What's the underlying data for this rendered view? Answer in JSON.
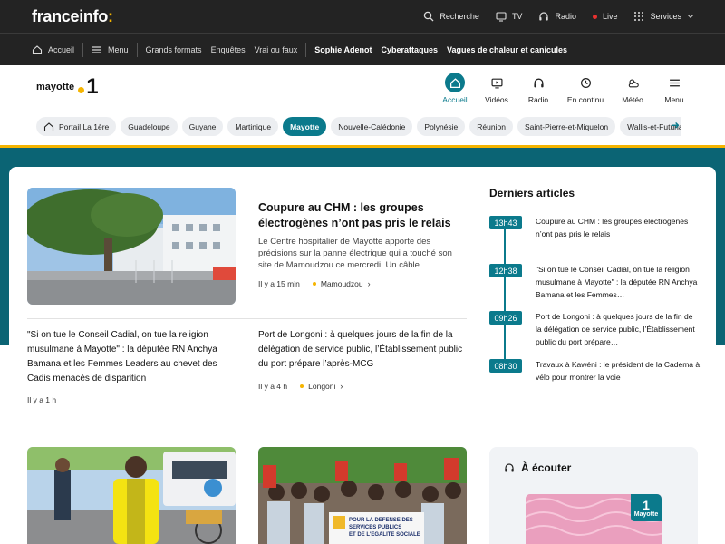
{
  "topbar": {
    "logo_main": "franceinfo",
    "logo_colon": ":",
    "search": "Recherche",
    "tv": "TV",
    "radio": "Radio",
    "live": "Live",
    "services": "Services"
  },
  "navbar": {
    "home": "Accueil",
    "menu": "Menu",
    "links": [
      "Grands formats",
      "Enquêtes",
      "Vrai ou faux"
    ],
    "bold_links": [
      "Sophie Adenot",
      "Cyberattaques",
      "Vagues de chaleur et canicules"
    ]
  },
  "header": {
    "brand_name": "mayotte",
    "brand_number": "1",
    "nav": [
      {
        "label": "Accueil",
        "icon": "home-icon"
      },
      {
        "label": "Vidéos",
        "icon": "play-icon"
      },
      {
        "label": "Radio",
        "icon": "headphones-icon"
      },
      {
        "label": "En continu",
        "icon": "clock-icon"
      },
      {
        "label": "Météo",
        "icon": "weather-icon"
      },
      {
        "label": "Menu",
        "icon": "hamburger-icon"
      }
    ],
    "regions": [
      "Portail La 1ère",
      "Guadeloupe",
      "Guyane",
      "Martinique",
      "Mayotte",
      "Nouvelle-Calédonie",
      "Polynésie",
      "Réunion",
      "Saint-Pierre-et-Miquelon",
      "Wallis-et-Futuna"
    ],
    "active_region": "Mayotte"
  },
  "main": {
    "lead": {
      "title": "Coupure au CHM : les groupes électrogènes n’ont pas pris le relais",
      "summary": "Le Centre hospitalier de Mayotte apporte des précisions sur la panne électrique qui a touché son site de Mamoudzou ce mercredi. Un câble…",
      "time": "Il y a 15 min",
      "location": "Mamoudzou"
    },
    "secondary": [
      {
        "title": "\"Si on tue le Conseil Cadial, on tue la religion musulmane à Mayotte\" : la députée RN Anchya Bamana et les Femmes Leaders au chevet des Cadis menacés de disparition",
        "time": "Il y a 1 h",
        "location": ""
      },
      {
        "title": "Port de Longoni : à quelques jours de la fin de la délégation de service public, l’Établissement public du port prépare l’après-MCG",
        "time": "Il y a 4 h",
        "location": "Longoni"
      }
    ]
  },
  "latest": {
    "title": "Derniers articles",
    "items": [
      {
        "time": "13h43",
        "text": "Coupure au CHM : les groupes électrogènes n’ont pas pris le relais"
      },
      {
        "time": "12h38",
        "text": "\"Si on tue le Conseil Cadial, on tue la religion musulmane à Mayotte\" : la députée RN Anchya Bamana et les Femmes…"
      },
      {
        "time": "09h26",
        "text": "Port de Longoni : à quelques jours de la fin de la délégation de service public, l’Établissement public du port prépare…"
      },
      {
        "time": "08h30",
        "text": "Travaux à Kawéni : le président de la Cadema à vélo pour montrer la voie"
      }
    ]
  },
  "listen": {
    "title": "À écouter",
    "badge_number": "1",
    "badge_name": "Mayotte"
  },
  "protest_sign": {
    "line1": "POUR LA DEFENSE DES",
    "line2": "SERVICES PUBLICS",
    "line3": "ET DE L'EGALITE SOCIALE"
  },
  "colors": {
    "accent": "#0b7a8c",
    "band": "#0b6474",
    "yellow": "#f5b400",
    "dark": "#232323"
  }
}
